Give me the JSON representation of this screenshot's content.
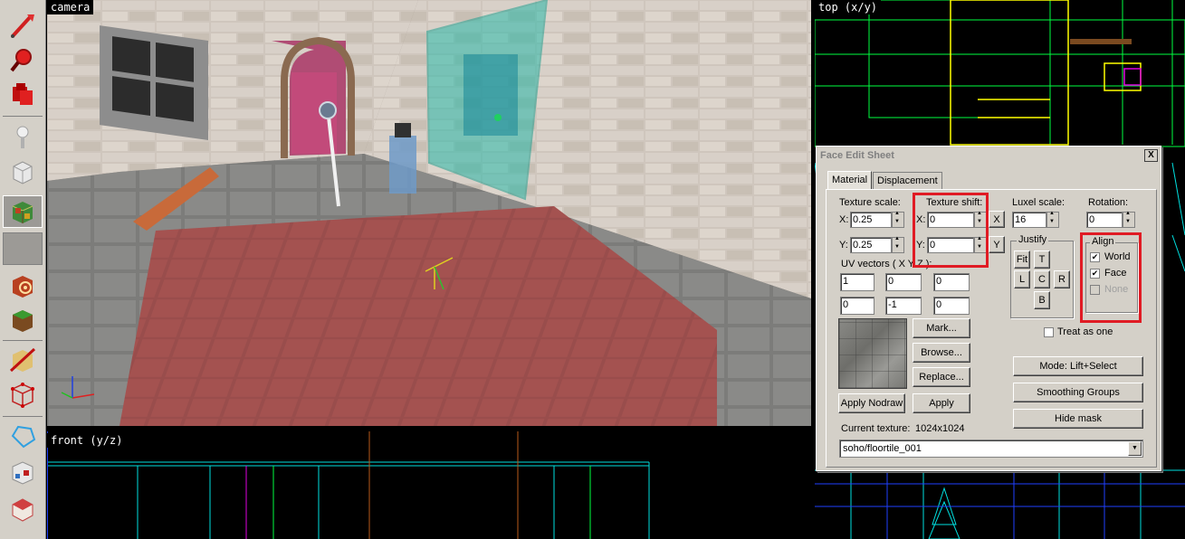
{
  "viewports": {
    "camera": "camera",
    "top": "top (x/y)",
    "front": "front (y/z)"
  },
  "toolbar": {
    "tools": [
      {
        "icon": "pointer-tool-icon"
      },
      {
        "icon": "magnify-tool-icon"
      },
      {
        "icon": "camera-tool-icon"
      },
      {
        "icon": "entity-tool-icon"
      },
      {
        "icon": "block-tool-icon"
      },
      {
        "icon": "texture-application-icon",
        "active": true
      },
      {
        "icon": "blank-tool-icon"
      },
      {
        "icon": "apply-decal-icon"
      },
      {
        "icon": "overlay-tool-icon"
      },
      {
        "icon": "clipping-tool-icon"
      },
      {
        "icon": "vertex-tool-icon"
      },
      {
        "icon": "path-tool-icon"
      },
      {
        "icon": "cordon-tool-icon"
      },
      {
        "icon": "brush-carve-icon"
      }
    ]
  },
  "face_edit_sheet": {
    "title": "Face Edit Sheet",
    "close": "X",
    "tabs": [
      "Material",
      "Displacement"
    ],
    "texture_scale": {
      "label": "Texture scale:",
      "x_label": "X:",
      "x": "0.25",
      "y_label": "Y:",
      "y": "0.25"
    },
    "texture_shift": {
      "label": "Texture shift:",
      "x_label": "X:",
      "x": "0",
      "y_label": "Y:",
      "y": "0",
      "x_btn": "X",
      "y_btn": "Y"
    },
    "luxel_scale": {
      "label": "Luxel scale:",
      "value": "16"
    },
    "rotation": {
      "label": "Rotation:",
      "value": "0"
    },
    "uv_vectors": {
      "label": "UV vectors ( X Y Z ):",
      "row1": [
        "1",
        "0",
        "0"
      ],
      "row2": [
        "0",
        "-1",
        "0"
      ]
    },
    "justify": {
      "label": "Justify",
      "buttons": [
        "Fit",
        "T",
        "L",
        "C",
        "R",
        "B"
      ]
    },
    "align": {
      "label": "Align",
      "world": "World",
      "face": "Face",
      "none": "None",
      "world_checked": true,
      "face_checked": true
    },
    "treat_as_one": "Treat as one",
    "buttons": {
      "mark": "Mark...",
      "browse": "Browse...",
      "replace": "Replace...",
      "apply_nodraw": "Apply Nodraw",
      "apply": "Apply",
      "mode": "Mode: Lift+Select",
      "smoothing": "Smoothing Groups",
      "hide_mask": "Hide mask"
    },
    "current_texture": {
      "label": "Current texture:",
      "size": "1024x1024",
      "name": "soho/floortile_001"
    }
  },
  "colors": {
    "annotation": "#e01b24",
    "dialog_bg": "#d4d0c8",
    "wire_green": "#00ff40",
    "wire_yellow": "#ffff00",
    "wire_cyan": "#00e0e0",
    "wire_magenta": "#e000e0"
  }
}
